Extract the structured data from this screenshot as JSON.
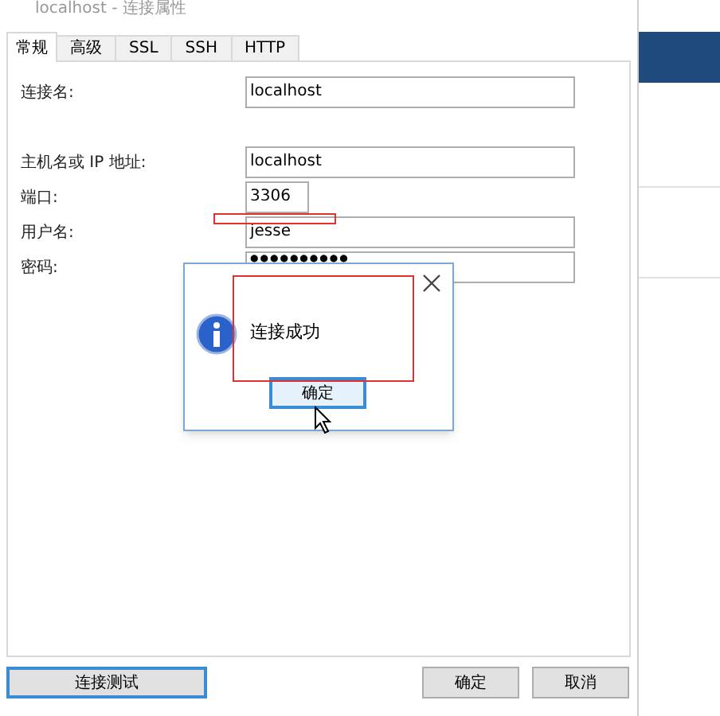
{
  "window": {
    "title": "localhost - 连接属性"
  },
  "tabs": [
    {
      "label": "常规",
      "selected": true
    },
    {
      "label": "高级",
      "selected": false
    },
    {
      "label": "SSL",
      "selected": false
    },
    {
      "label": "SSH",
      "selected": false
    },
    {
      "label": "HTTP",
      "selected": false
    }
  ],
  "fields": [
    {
      "kind": "text",
      "label": "连接名:",
      "value": "localhost"
    },
    {
      "kind": "text",
      "label": "主机名或 IP 地址:",
      "value": "localhost"
    },
    {
      "kind": "port",
      "label": "端口:",
      "value": "3306"
    },
    {
      "kind": "text",
      "label": "用户名:",
      "value": "jesse"
    },
    {
      "kind": "password",
      "label": "密码:",
      "value": "●●●●●●●●●●"
    }
  ],
  "message_box": {
    "text": "连接成功",
    "button": "确定"
  },
  "buttons": [
    {
      "label": "连接测试",
      "focused": true
    },
    {
      "label": "确定",
      "focused": false
    },
    {
      "label": "取消",
      "focused": false
    }
  ]
}
